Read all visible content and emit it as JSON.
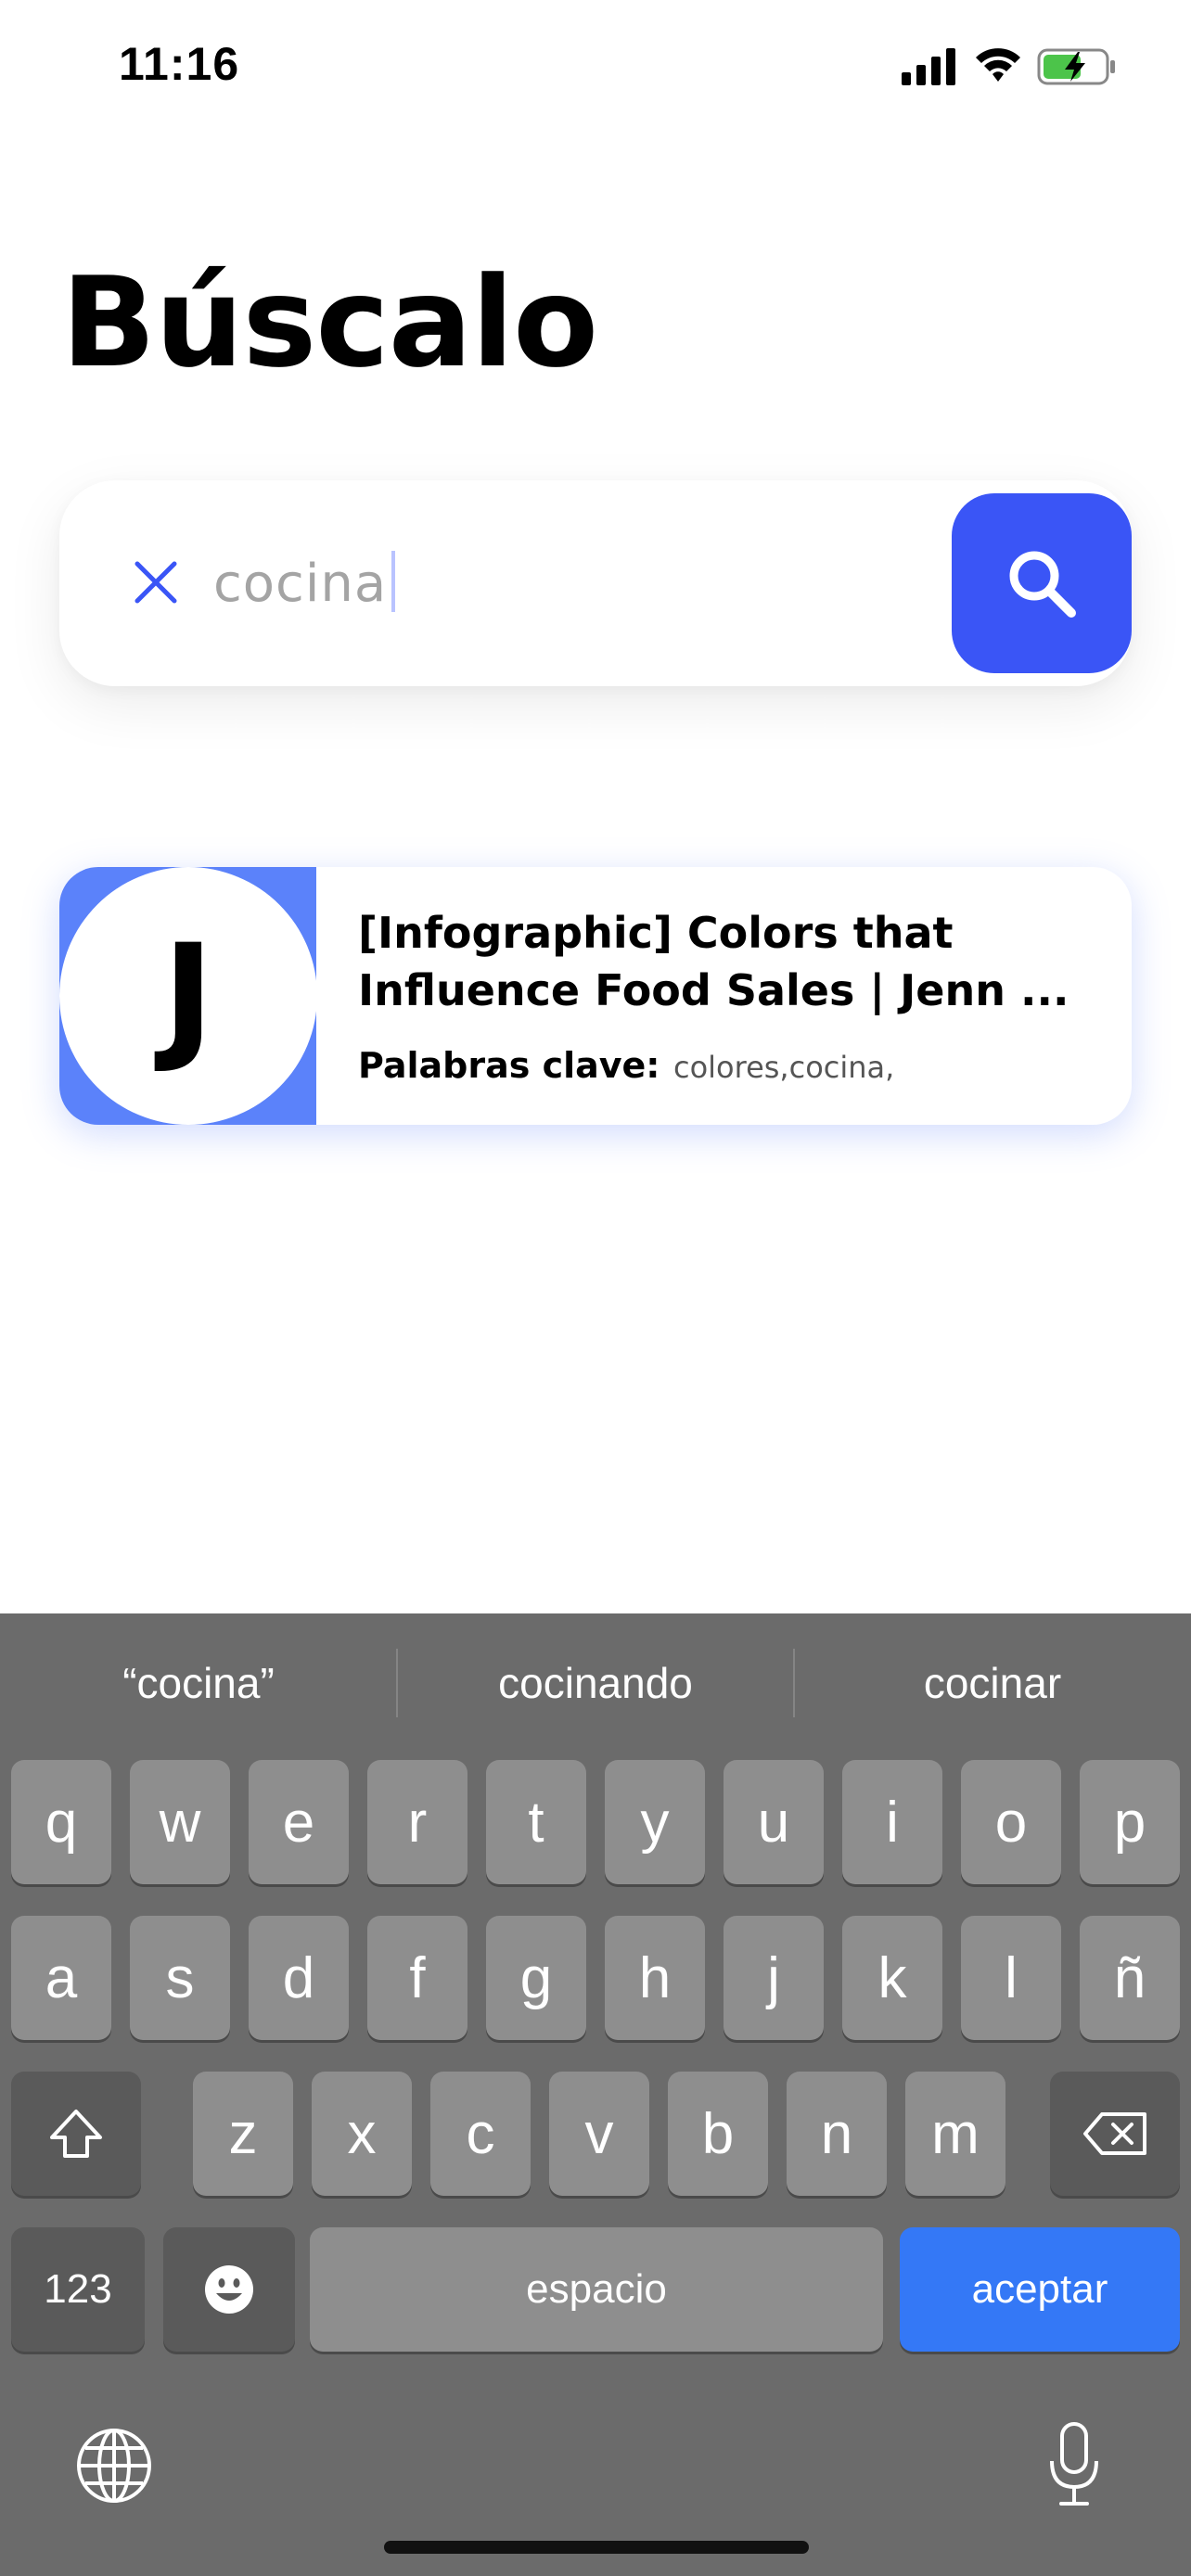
{
  "status_bar": {
    "time": "11:16"
  },
  "title": "Búscalo",
  "search": {
    "value": "cocina",
    "button_icon": "search-icon",
    "clear_icon": "close-icon"
  },
  "result": {
    "avatar_letter": "J",
    "title": "[Infographic] Colors that Influence Food Sales | Jenn ...",
    "keywords_label": "Palabras clave:",
    "keywords_value": "colores,cocina,"
  },
  "keyboard": {
    "suggestions": [
      "“cocina”",
      "cocinando",
      "cocinar"
    ],
    "row1": [
      "q",
      "w",
      "e",
      "r",
      "t",
      "y",
      "u",
      "i",
      "o",
      "p"
    ],
    "row2": [
      "a",
      "s",
      "d",
      "f",
      "g",
      "h",
      "j",
      "k",
      "l",
      "ñ"
    ],
    "row3": [
      "z",
      "x",
      "c",
      "v",
      "b",
      "n",
      "m"
    ],
    "numbers_key": "123",
    "space_key": "espacio",
    "return_key": "aceptar"
  },
  "colors": {
    "accent": "#3a55f6",
    "avatar_bg": "#5b82fa",
    "keyboard_bg": "#6b6b6b",
    "key_bg": "#8e8e8e",
    "return_key": "#3478f6"
  }
}
